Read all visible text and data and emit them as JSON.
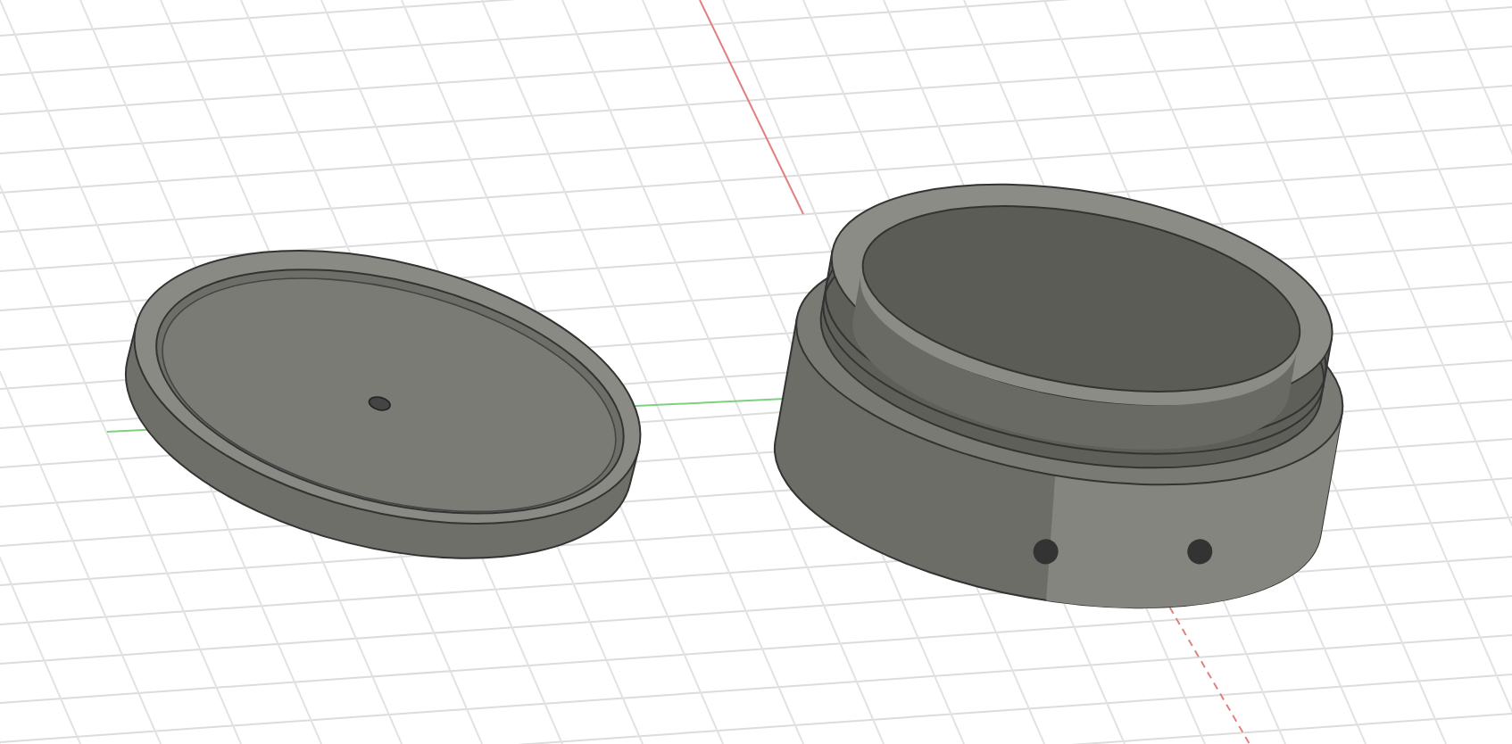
{
  "viewport": {
    "objects": [
      {
        "kind": "lid"
      },
      {
        "kind": "container"
      }
    ]
  }
}
